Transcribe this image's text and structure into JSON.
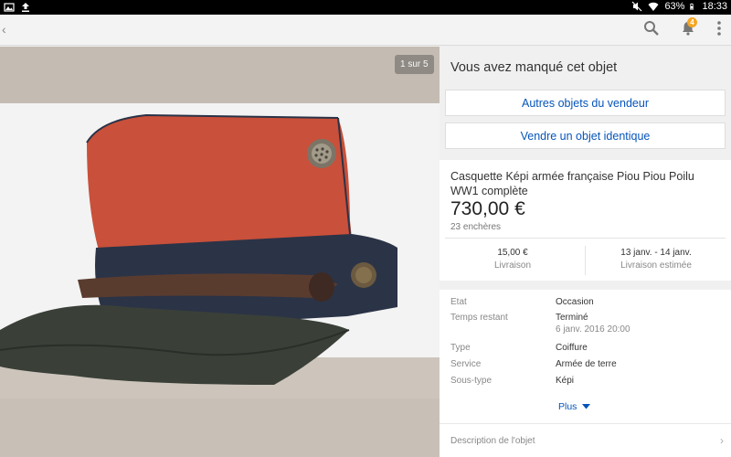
{
  "status_bar": {
    "battery": "63%",
    "time": "18:33",
    "icons": [
      "image-icon",
      "upload-icon",
      "mute-icon",
      "wifi-icon",
      "battery-icon"
    ]
  },
  "action_bar": {
    "back": "‹",
    "notification_count": "4",
    "icons": [
      "search-icon",
      "bell-icon",
      "overflow-menu-icon"
    ]
  },
  "photo": {
    "counter": "1 sur 5"
  },
  "panel": {
    "missed_heading": "Vous avez manqué cet objet",
    "seller_button": "Autres objets du vendeur",
    "sell_similar_button": "Vendre un objet identique",
    "item_title": "Casquette Képi armée française Piou Piou Poilu WW1 complète",
    "price": "730,00 €",
    "bids": "23 enchères",
    "shipping_cost": "15,00 €",
    "shipping_label": "Livraison",
    "delivery_dates": "13 janv. - 14 janv.",
    "delivery_label": "Livraison estimée",
    "specs": [
      {
        "key": "Etat",
        "value": "Occasion",
        "sub": ""
      },
      {
        "key": "Temps restant",
        "value": "Terminé",
        "sub": "6 janv. 2016 20:00"
      },
      {
        "key": "Type",
        "value": "Coiffure",
        "sub": ""
      },
      {
        "key": "Service",
        "value": "Armée de terre",
        "sub": ""
      },
      {
        "key": "Sous-type",
        "value": "Képi",
        "sub": ""
      }
    ],
    "more_link": "Plus",
    "description_label": "Description de l'objet"
  },
  "colors": {
    "link_blue": "#0654ba",
    "badge_orange": "#f5a623",
    "kepi_red": "#c9503a",
    "kepi_navy": "#2b3347"
  }
}
